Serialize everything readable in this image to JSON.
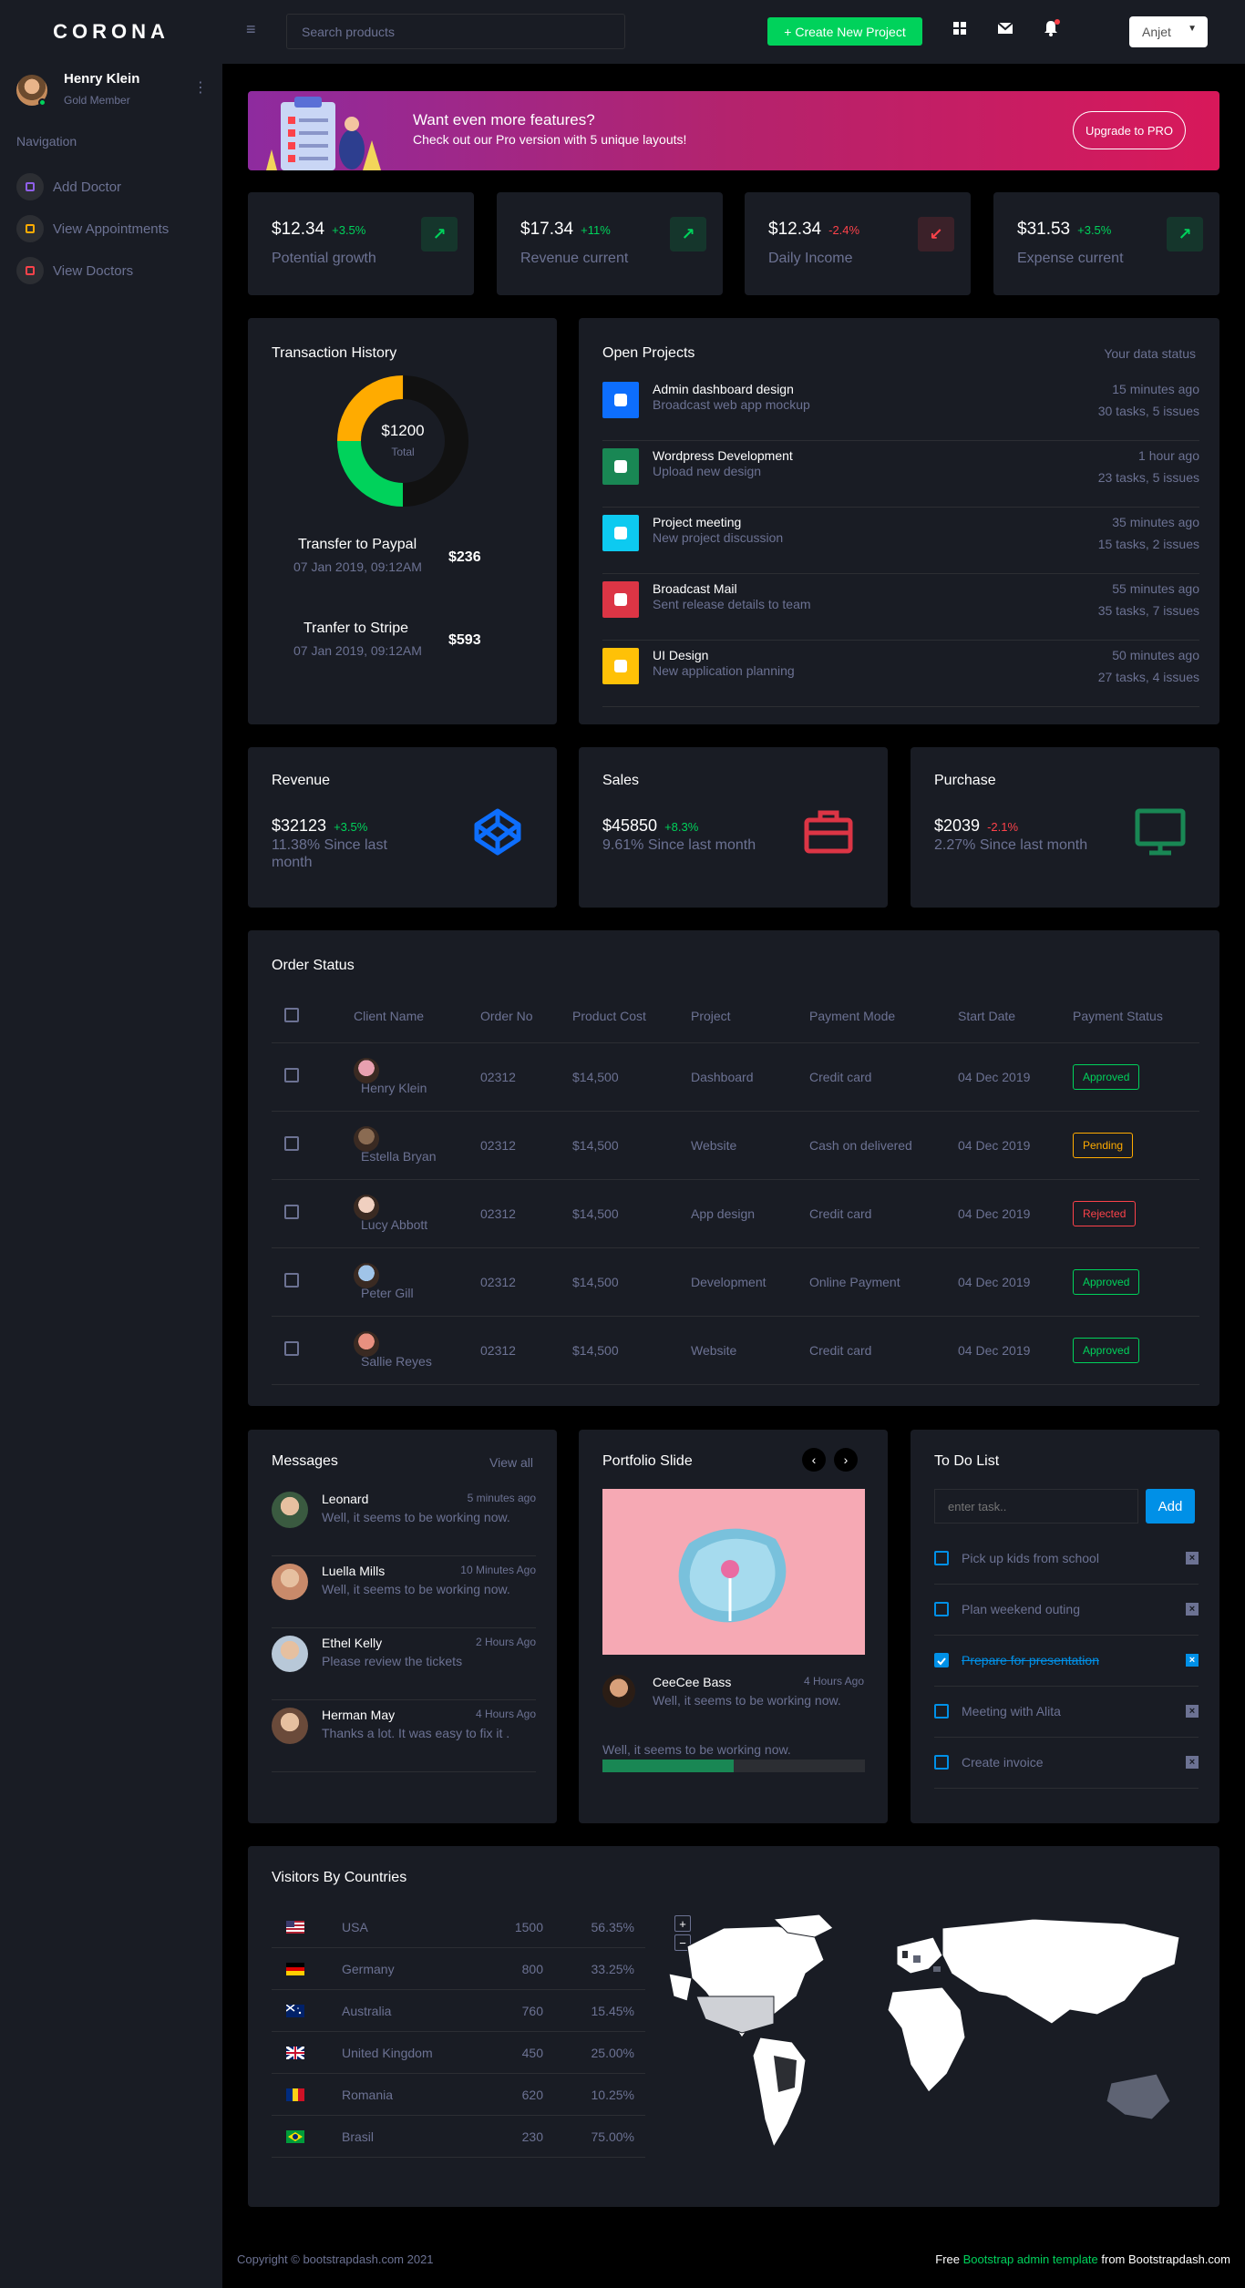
{
  "brand": "CORONA",
  "topbar": {
    "search_placeholder": "Search products",
    "create_label": "+ Create New Project",
    "user_label": "Anjet"
  },
  "profile": {
    "name": "Henry Klein",
    "role": "Gold Member"
  },
  "sidebar": {
    "category": "Navigation",
    "items": [
      {
        "label": "Add Doctor",
        "color": "#8f5fe8"
      },
      {
        "label": "View Appointments",
        "color": "#ffab00"
      },
      {
        "label": "View Doctors",
        "color": "#fc424a"
      }
    ]
  },
  "banner": {
    "title": "Want even more features?",
    "subtitle": "Check out our Pro version with 5 unique layouts!",
    "button": "Upgrade to PRO"
  },
  "stats": [
    {
      "value": "$12.34",
      "change": "+3.5%",
      "label": "Potential growth",
      "trend": "up"
    },
    {
      "value": "$17.34",
      "change": "+11%",
      "label": "Revenue current",
      "trend": "up"
    },
    {
      "value": "$12.34",
      "change": "-2.4%",
      "label": "Daily Income",
      "trend": "down"
    },
    {
      "value": "$31.53",
      "change": "+3.5%",
      "label": "Expense current",
      "trend": "up"
    }
  ],
  "transactions": {
    "title": "Transaction History",
    "donut_value": "$1200",
    "donut_label": "Total",
    "items": [
      {
        "name": "Transfer to Paypal",
        "date": "07 Jan 2019, 09:12AM",
        "amount": "$236"
      },
      {
        "name": "Tranfer to Stripe",
        "date": "07 Jan 2019, 09:12AM",
        "amount": "$593"
      }
    ]
  },
  "projects": {
    "title": "Open Projects",
    "subtitle": "Your data status",
    "items": [
      {
        "title": "Admin dashboard design",
        "subtitle": "Broadcast web app mockup",
        "time": "15 minutes ago",
        "meta": "30 tasks, 5 issues",
        "color": "#0d6efd"
      },
      {
        "title": "Wordpress Development",
        "subtitle": "Upload new design",
        "time": "1 hour ago",
        "meta": "23 tasks, 5 issues",
        "color": "#198754"
      },
      {
        "title": "Project meeting",
        "subtitle": "New project discussion",
        "time": "35 minutes ago",
        "meta": "15 tasks, 2 issues",
        "color": "#0dcaf0"
      },
      {
        "title": "Broadcast Mail",
        "subtitle": "Sent release details to team",
        "time": "55 minutes ago",
        "meta": "35 tasks, 7 issues",
        "color": "#dc3545"
      },
      {
        "title": "UI Design",
        "subtitle": "New application planning",
        "time": "50 minutes ago",
        "meta": "27 tasks, 4 issues",
        "color": "#ffc107"
      }
    ]
  },
  "minis": [
    {
      "title": "Revenue",
      "value": "$32123",
      "change": "+3.5%",
      "sub": "11.38% Since last month",
      "trend": "up"
    },
    {
      "title": "Sales",
      "value": "$45850",
      "change": "+8.3%",
      "sub": "9.61% Since last month",
      "trend": "up"
    },
    {
      "title": "Purchase",
      "value": "$2039",
      "change": "-2.1%",
      "sub": "2.27% Since last month",
      "trend": "down"
    }
  ],
  "orders": {
    "title": "Order Status",
    "headers": [
      "Client Name",
      "Order No",
      "Product Cost",
      "Project",
      "Payment Mode",
      "Start Date",
      "Payment Status"
    ],
    "rows": [
      {
        "client": "Henry Klein",
        "no": "02312",
        "cost": "$14,500",
        "project": "Dashboard",
        "mode": "Credit card",
        "date": "04 Dec 2019",
        "status": "Approved"
      },
      {
        "client": "Estella Bryan",
        "no": "02312",
        "cost": "$14,500",
        "project": "Website",
        "mode": "Cash on delivered",
        "date": "04 Dec 2019",
        "status": "Pending"
      },
      {
        "client": "Lucy Abbott",
        "no": "02312",
        "cost": "$14,500",
        "project": "App design",
        "mode": "Credit card",
        "date": "04 Dec 2019",
        "status": "Rejected"
      },
      {
        "client": "Peter Gill",
        "no": "02312",
        "cost": "$14,500",
        "project": "Development",
        "mode": "Online Payment",
        "date": "04 Dec 2019",
        "status": "Approved"
      },
      {
        "client": "Sallie Reyes",
        "no": "02312",
        "cost": "$14,500",
        "project": "Website",
        "mode": "Credit card",
        "date": "04 Dec 2019",
        "status": "Approved"
      }
    ]
  },
  "messages": {
    "title": "Messages",
    "view_all": "View all",
    "items": [
      {
        "name": "Leonard",
        "text": "Well, it seems to be working now.",
        "time": "5 minutes ago"
      },
      {
        "name": "Luella Mills",
        "text": "Well, it seems to be working now.",
        "time": "10 Minutes Ago"
      },
      {
        "name": "Ethel Kelly",
        "text": "Please review the tickets",
        "time": "2 Hours Ago"
      },
      {
        "name": "Herman May",
        "text": "Thanks a lot. It was easy to fix it .",
        "time": "4 Hours Ago"
      }
    ]
  },
  "portfolio": {
    "title": "Portfolio Slide",
    "name": "CeeCee Bass",
    "time": "4 Hours Ago",
    "text": "Well, it seems to be working now.",
    "caption": "Well, it seems to be working now.",
    "progress": 0.5
  },
  "todo": {
    "title": "To Do List",
    "placeholder": "enter task..",
    "add": "Add",
    "items": [
      {
        "text": "Pick up kids from school",
        "done": false
      },
      {
        "text": "Plan weekend outing",
        "done": false
      },
      {
        "text": "Prepare for presentation",
        "done": true
      },
      {
        "text": "Meeting with Alita",
        "done": false
      },
      {
        "text": "Create invoice",
        "done": false
      }
    ]
  },
  "visitors": {
    "title": "Visitors By Countries",
    "zoom_in": "+",
    "zoom_out": "−",
    "rows": [
      {
        "country": "USA",
        "count": "1500",
        "pct": "56.35%"
      },
      {
        "country": "Germany",
        "count": "800",
        "pct": "33.25%"
      },
      {
        "country": "Australia",
        "count": "760",
        "pct": "15.45%"
      },
      {
        "country": "United Kingdom",
        "count": "450",
        "pct": "25.00%"
      },
      {
        "country": "Romania",
        "count": "620",
        "pct": "10.25%"
      },
      {
        "country": "Brasil",
        "count": "230",
        "pct": "75.00%"
      }
    ]
  },
  "footer": {
    "copyright": "Copyright © bootstrapdash.com 2021",
    "free": "Free ",
    "link": "Bootstrap admin template",
    "from": " from Bootstrapdash.com"
  },
  "colors": {
    "green": "#00d25b",
    "red": "#fc424a",
    "blue": "#0090e7",
    "muted": "#6c7293",
    "card": "#191c24"
  }
}
